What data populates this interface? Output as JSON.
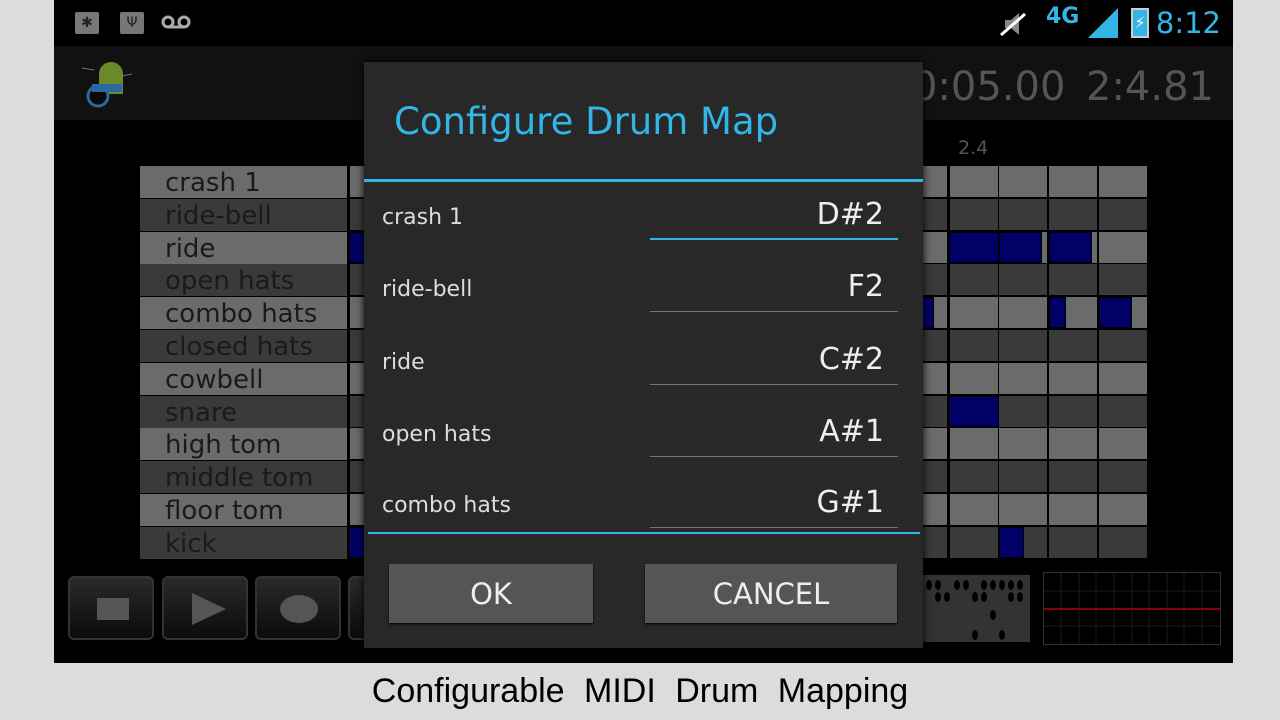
{
  "status_bar": {
    "icons": [
      "bug-icon",
      "usb-icon",
      "voicemail-icon",
      "mute-icon",
      "4g-lte-icon",
      "signal-icon",
      "battery-charging-icon"
    ],
    "network": "4G",
    "clock": "8:12",
    "accent": "#33b5e5"
  },
  "action_bar": {
    "logo": "drum-android-logo",
    "elapsed": "0:05.00",
    "position": "2:4.81"
  },
  "grid": {
    "beat_label": "2.4",
    "instruments": [
      "crash 1",
      "ride-bell",
      "ride",
      "open hats",
      "combo hats",
      "closed hats",
      "cowbell",
      "snare",
      "high tom",
      "middle tom",
      "floor tom",
      "kick"
    ],
    "steps": 16,
    "note_color": "#000066",
    "notes": [
      {
        "row": 2,
        "step": 0,
        "length": 0.5
      },
      {
        "row": 11,
        "step": 0,
        "length": 0.5
      },
      {
        "row": 2,
        "step": 12,
        "length": 1
      },
      {
        "row": 2,
        "step": 13,
        "length": 0.85
      },
      {
        "row": 2,
        "step": 14,
        "length": 0.85
      },
      {
        "row": 4,
        "step": 11,
        "length": 0.7
      },
      {
        "row": 4,
        "step": 14,
        "length": 0.33
      },
      {
        "row": 4,
        "step": 15,
        "length": 0.66
      },
      {
        "row": 7,
        "step": 12,
        "length": 1
      },
      {
        "row": 11,
        "step": 13,
        "length": 0.5
      }
    ]
  },
  "transport": [
    {
      "icon": "stop-icon"
    },
    {
      "icon": "play-icon"
    },
    {
      "icon": "record-icon"
    }
  ],
  "dialog": {
    "title": "Configure Drum Map",
    "rows": [
      {
        "name": "crash 1",
        "value": "D#2"
      },
      {
        "name": "ride-bell",
        "value": "F2"
      },
      {
        "name": "ride",
        "value": "C#2"
      },
      {
        "name": "open hats",
        "value": "A#1"
      },
      {
        "name": "combo hats",
        "value": "G#1"
      }
    ],
    "ok": "OK",
    "cancel": "CANCEL"
  },
  "caption": "Configurable MIDI Drum Mapping"
}
